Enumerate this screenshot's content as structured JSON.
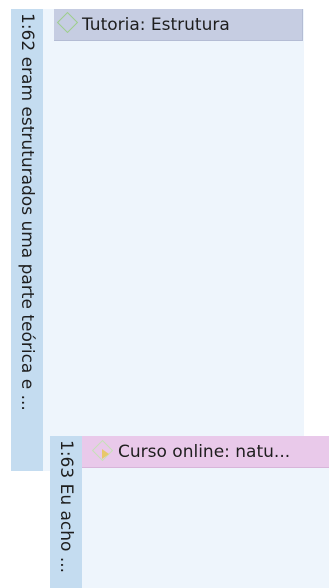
{
  "quotations": [
    {
      "id_label": "1:62 eram estruturados uma parte teórica e ...",
      "code_label": "Tutoria: Estrutura",
      "code_color": "#c6cde2",
      "code_icon": "code-diamond-icon"
    },
    {
      "id_label": "1:63 Eu acho ...",
      "code_label": "Curso online: natu...",
      "code_color": "#e9c9ea",
      "code_icon": "code-diamond-arrow-icon"
    }
  ]
}
